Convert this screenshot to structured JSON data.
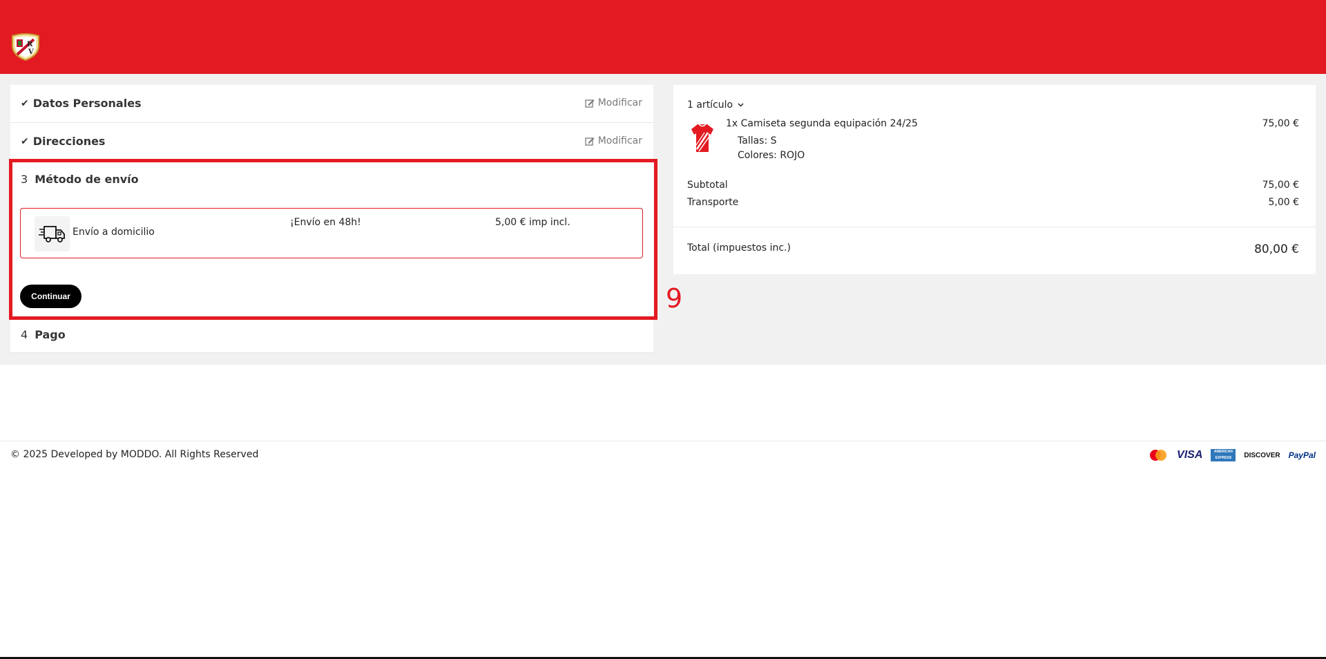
{
  "header": {
    "logo_alt": "Rayo Vallecano crest",
    "logo_text": "RV"
  },
  "steps": {
    "personal": {
      "title": "Datos Personales",
      "modify_label": "Modificar"
    },
    "addresses": {
      "title": "Direcciones",
      "modify_label": "Modificar"
    },
    "shipping": {
      "number": "3",
      "title": "Método de envío",
      "carrier": {
        "name": "Envío a domicilio",
        "delay": "¡Envío en 48h!",
        "price": "5,00 € imp incl."
      },
      "continue_label": "Continuar"
    },
    "payment": {
      "number": "4",
      "title": "Pago"
    }
  },
  "annotation": {
    "label": "9"
  },
  "summary": {
    "items_count": "1 artículo",
    "product": {
      "name": "1x Camiseta segunda equipación 24/25",
      "price": "75,00 €",
      "size": "Tallas: S",
      "color": "Colores: ROJO"
    },
    "subtotal_label": "Subtotal",
    "subtotal_value": "75,00 €",
    "shipping_label": "Transporte",
    "shipping_value": "5,00 €",
    "total_label": "Total (impuestos inc.)",
    "total_value": "80,00 €"
  },
  "footer": {
    "copyright": "© 2025 Developed by MODDO. All Rights Reserved",
    "payment_methods": [
      "mastercard-icon",
      "visa-icon",
      "amex-icon",
      "discover-icon",
      "paypal-icon"
    ],
    "visa": "VISA",
    "amex": "AMERICAN EXPRESS",
    "discover": "DISCOVER",
    "paypal": "PayPal"
  },
  "colors": {
    "brand_red": "#e31a22",
    "background_gray": "#f1f1f1",
    "button_black": "#000000"
  }
}
